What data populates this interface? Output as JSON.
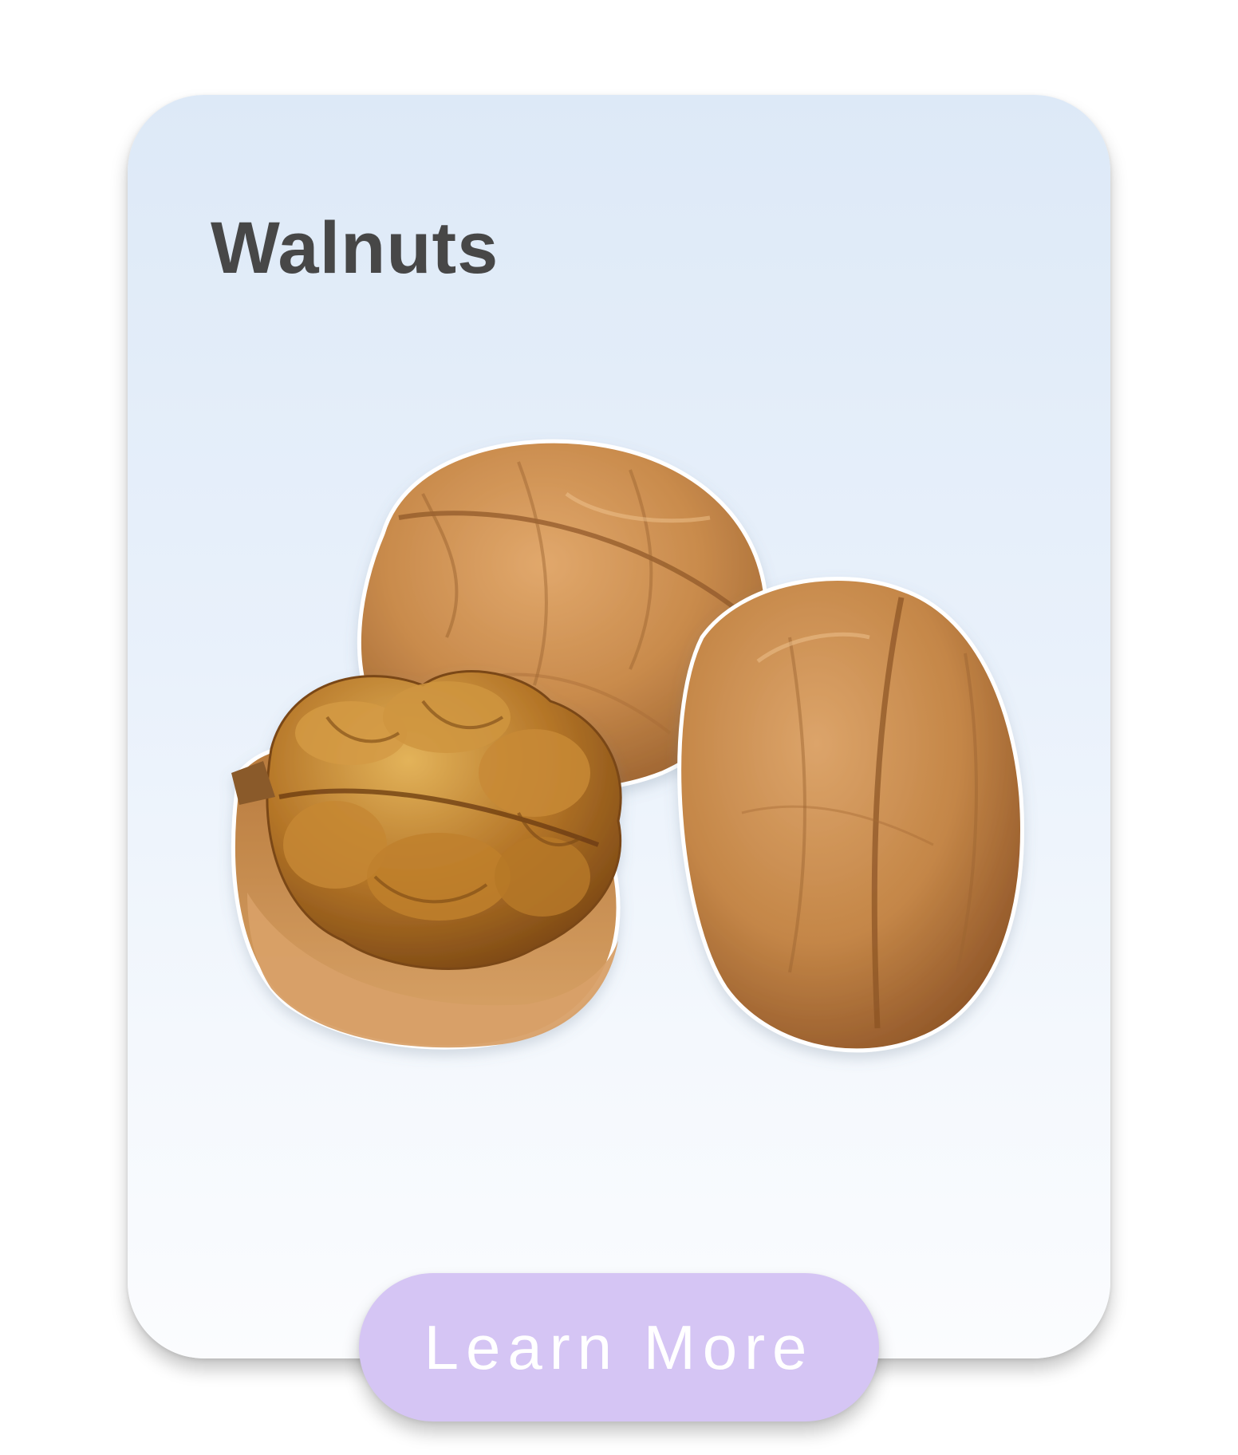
{
  "card": {
    "title": "Walnuts",
    "image_subject": "walnut-illustration"
  },
  "actions": {
    "learn_more_label": "Learn More"
  },
  "colors": {
    "card_gradient_top": "#dde9f7",
    "card_gradient_bottom": "#fbfcfe",
    "title_text": "#474747",
    "button_bg": "#d5c5f4",
    "button_text": "#ffffff",
    "walnut_shell": "#c98b4c",
    "walnut_kernel": "#b57628"
  }
}
